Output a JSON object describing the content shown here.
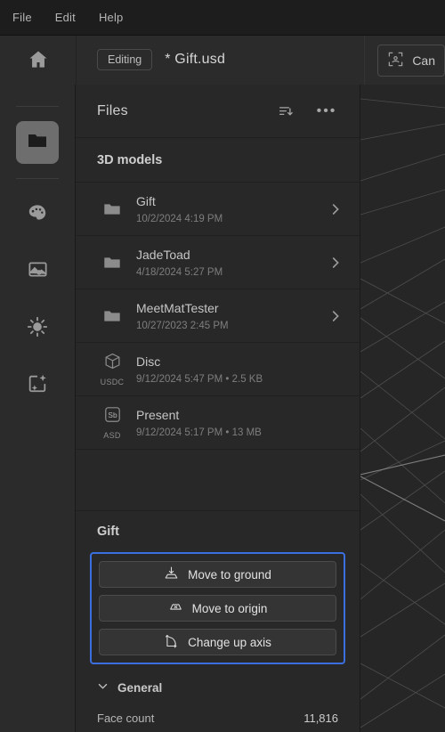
{
  "menubar": {
    "items": [
      "File",
      "Edit",
      "Help"
    ]
  },
  "topbar": {
    "home_icon": "home-icon",
    "mode_label": "Editing",
    "document_title": "* Gift.usd",
    "canvas_label": "Can",
    "canvas_icon": "canvas-frame-icon"
  },
  "rail": {
    "items": [
      {
        "icon": "folder-icon",
        "name": "files",
        "active": true
      },
      {
        "icon": "palette-icon",
        "name": "materials",
        "active": false
      },
      {
        "icon": "image-icon",
        "name": "scene",
        "active": false
      },
      {
        "icon": "sun-icon",
        "name": "lighting",
        "active": false
      },
      {
        "icon": "magic-wand-icon",
        "name": "effects",
        "active": false
      }
    ]
  },
  "panel": {
    "title": "Files",
    "sort_icon": "sort-descending-icon",
    "more_icon": "more-options-icon",
    "section_label": "3D models",
    "files": [
      {
        "name": "Gift",
        "meta": "10/2/2024 4:19 PM",
        "icon": "folder-icon",
        "ext": "",
        "chevron": true
      },
      {
        "name": "JadeToad",
        "meta": "4/18/2024 5:27 PM",
        "icon": "folder-icon",
        "ext": "",
        "chevron": true
      },
      {
        "name": "MeetMatTester",
        "meta": "10/27/2023 2:45 PM",
        "icon": "folder-icon",
        "ext": "",
        "chevron": true
      },
      {
        "name": "Disc",
        "meta": "9/12/2024 5:47 PM • 2.5 KB",
        "icon": "cube-icon",
        "ext": "USDC",
        "chevron": false
      },
      {
        "name": "Present",
        "meta": "9/12/2024 5:17 PM • 13 MB",
        "icon": "substance-icon",
        "ext": "ASD",
        "chevron": false
      }
    ]
  },
  "selection": {
    "title": "Gift",
    "highlight_color": "#3b6fe0",
    "actions": [
      {
        "label": "Move to ground",
        "icon": "move-to-ground-icon"
      },
      {
        "label": "Move to origin",
        "icon": "move-to-origin-icon"
      },
      {
        "label": "Change up axis",
        "icon": "change-up-axis-icon"
      }
    ],
    "general": {
      "label": "General",
      "chevron_icon": "chevron-down-icon",
      "properties": [
        {
          "key": "Face count",
          "value": "11,816"
        }
      ]
    }
  },
  "viewport": {
    "name": "3d-viewport",
    "background": "#262626",
    "grid_color": "#4a4a4a"
  }
}
